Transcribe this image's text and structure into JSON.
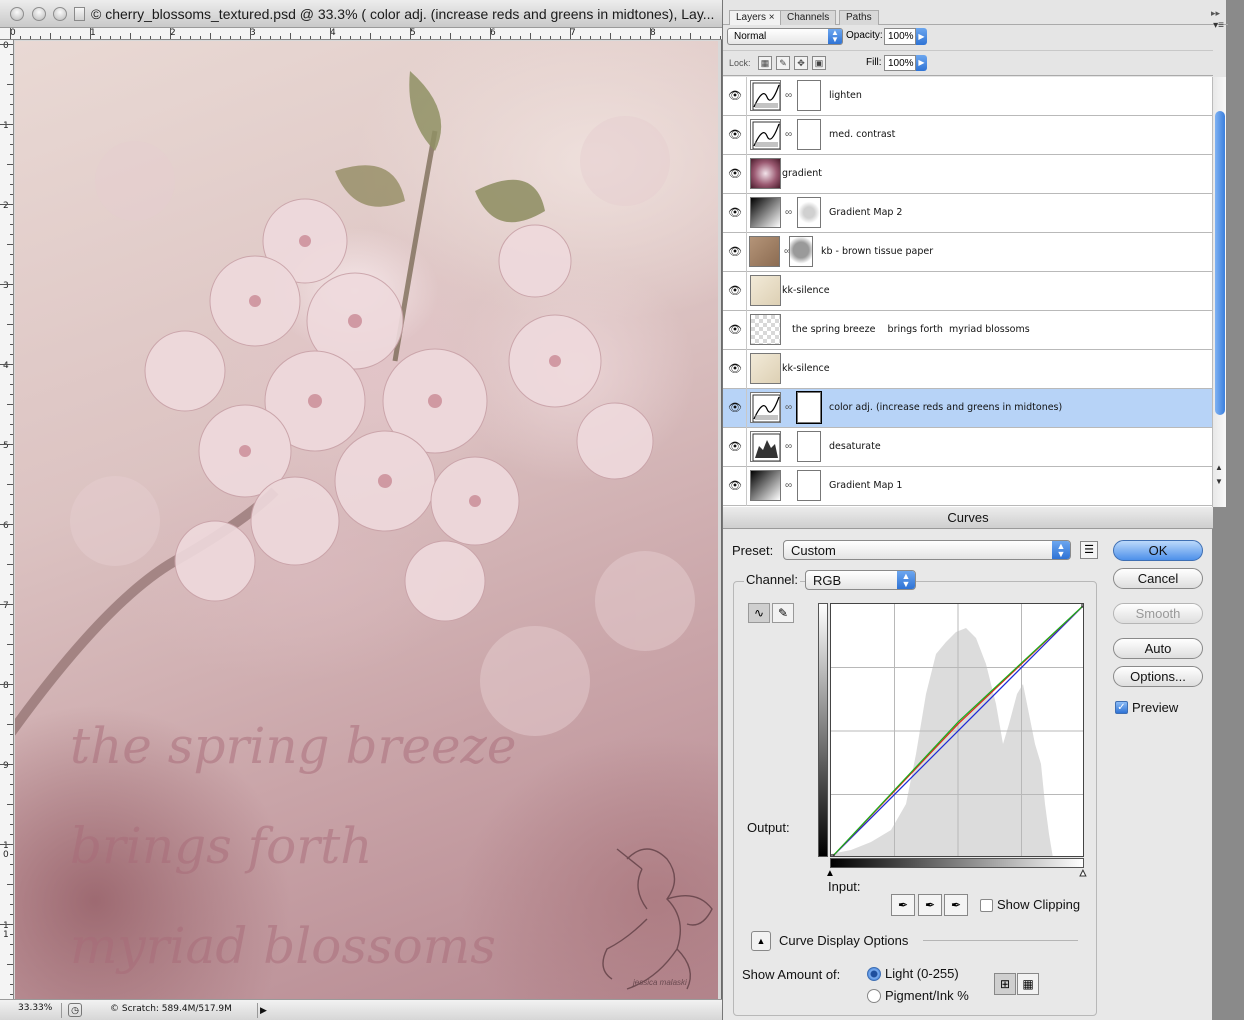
{
  "document": {
    "title": "© cherry_blossoms_textured.psd @ 33.3% ( color adj. (increase reds and greens in midtones), Lay...",
    "ruler_top": [
      "0",
      "1",
      "2",
      "3",
      "4",
      "5",
      "6",
      "7",
      "8"
    ],
    "ruler_left": [
      "0",
      "1",
      "2",
      "3",
      "4",
      "5",
      "6",
      "7",
      "8",
      "9",
      "1\n0",
      "1\n1"
    ],
    "canvas_text": "the spring breeze\nbrings forth\nmyriad blossoms",
    "signature": "jessica malaski",
    "status": {
      "zoom": "33.33%",
      "scratch": "© Scratch: 589.4M/517.9M"
    }
  },
  "layers_panel": {
    "tabs": [
      {
        "label": "Layers",
        "close": "×",
        "active": true
      },
      {
        "label": "Channels",
        "active": false
      },
      {
        "label": "Paths",
        "active": false
      }
    ],
    "blend_mode": "Normal",
    "opacity_label": "Opacity:",
    "opacity": "100%",
    "lock_label": "Lock:",
    "fill_label": "Fill:",
    "fill": "100%",
    "layers": [
      {
        "name": "lighten",
        "type": "curves",
        "mask": true,
        "selected": false
      },
      {
        "name": "med. contrast",
        "type": "curves",
        "mask": true,
        "selected": false
      },
      {
        "name": "gradient",
        "type": "gradient",
        "mask": false,
        "selected": false
      },
      {
        "name": "Gradient Map 2",
        "type": "gradmap",
        "mask": true,
        "selected": false
      },
      {
        "name": "kb - brown tissue paper",
        "type": "texture",
        "mask": true,
        "selected": false
      },
      {
        "name": "kk-silence",
        "type": "paper",
        "mask": false,
        "selected": false
      },
      {
        "name": "the spring breeze    brings forth  myriad blossoms",
        "type": "text",
        "mask": false,
        "selected": false
      },
      {
        "name": "kk-silence",
        "type": "paper",
        "mask": false,
        "selected": false
      },
      {
        "name": "color adj. (increase reds and greens in midtones)",
        "type": "curves",
        "mask": true,
        "selected": true
      },
      {
        "name": "desaturate",
        "type": "levels",
        "mask": true,
        "selected": false
      },
      {
        "name": "Gradient Map 1",
        "type": "gradmap",
        "mask": true,
        "selected": false
      }
    ]
  },
  "curves": {
    "title": "Curves",
    "preset_label": "Preset:",
    "preset": "Custom",
    "channel_label": "Channel:",
    "channel": "RGB",
    "output_label": "Output:",
    "input_label": "Input:",
    "buttons": {
      "ok": "OK",
      "cancel": "Cancel",
      "smooth": "Smooth",
      "auto": "Auto",
      "options": "Options..."
    },
    "preview_label": "Preview",
    "preview_checked": true,
    "show_clipping_label": "Show Clipping",
    "show_clipping_checked": false,
    "curve_display_options": "Curve Display Options",
    "show_amount_label": "Show Amount of:",
    "light_option": "Light  (0-255)",
    "pigment_option": "Pigment/Ink %",
    "curve_colors": {
      "red": "#e0241c",
      "green": "#16b21c",
      "blue": "#1e2ad8",
      "rgb": "#000000"
    },
    "curve_points": {
      "red": [
        [
          0,
          0
        ],
        [
          128,
          135
        ],
        [
          255,
          255
        ]
      ],
      "green": [
        [
          0,
          0
        ],
        [
          128,
          137
        ],
        [
          255,
          255
        ]
      ],
      "blue": [
        [
          0,
          0
        ],
        [
          255,
          255
        ]
      ]
    }
  }
}
